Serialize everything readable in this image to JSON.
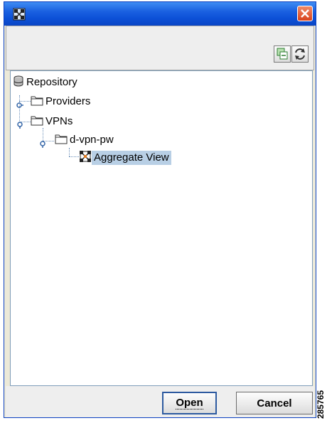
{
  "window": {
    "icon": "network-diagram-icon",
    "close_icon": "close-icon"
  },
  "toolbar": {
    "buttons": [
      {
        "icon": "collapse-all-icon"
      },
      {
        "icon": "refresh-icon"
      }
    ]
  },
  "tree": {
    "nodes": [
      {
        "label": "Repository",
        "icon": "database-icon"
      },
      {
        "label": "Providers",
        "icon": "folder-icon"
      },
      {
        "label": "VPNs",
        "icon": "folder-icon"
      },
      {
        "label": "d-vpn-pw",
        "icon": "folder-icon"
      },
      {
        "label": "Aggregate View",
        "icon": "aggregate-view-icon",
        "selected": true
      }
    ]
  },
  "footer": {
    "open_label": "Open",
    "cancel_label": "Cancel"
  },
  "side_stamp": "285765",
  "colors": {
    "titlebar": "#0c50d7",
    "selection": "#b8cfe5",
    "close": "#d8421c"
  }
}
